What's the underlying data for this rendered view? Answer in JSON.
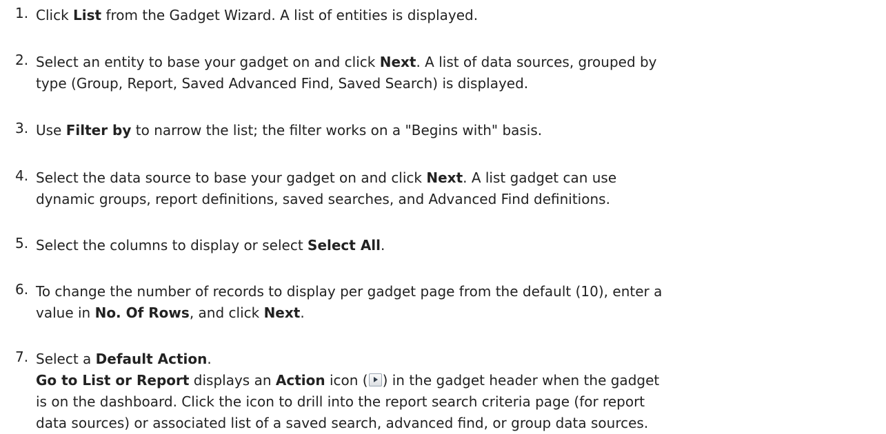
{
  "steps": [
    {
      "num": "1.",
      "lines": [
        {
          "parts": [
            {
              "t": "Click "
            },
            {
              "t": "List",
              "b": true
            },
            {
              "t": " from the Gadget Wizard. A list of entities is displayed."
            }
          ]
        }
      ]
    },
    {
      "num": "2.",
      "lines": [
        {
          "parts": [
            {
              "t": "Select an entity to base your gadget on and click "
            },
            {
              "t": "Next",
              "b": true
            },
            {
              "t": ". A list of data sources, grouped by"
            }
          ]
        },
        {
          "parts": [
            {
              "t": "type (Group, Report, Saved Advanced Find, Saved Search) is displayed."
            }
          ]
        }
      ]
    },
    {
      "num": "3.",
      "lines": [
        {
          "parts": [
            {
              "t": "Use "
            },
            {
              "t": "Filter by",
              "b": true
            },
            {
              "t": " to narrow the list; the filter works on a \"Begins with\" basis."
            }
          ]
        }
      ]
    },
    {
      "num": "4.",
      "lines": [
        {
          "parts": [
            {
              "t": "Select the data source to base your gadget on and click "
            },
            {
              "t": "Next",
              "b": true
            },
            {
              "t": ". A list gadget can use"
            }
          ]
        },
        {
          "parts": [
            {
              "t": "dynamic groups, report definitions, saved searches, and Advanced Find definitions."
            }
          ]
        }
      ]
    },
    {
      "num": "5.",
      "lines": [
        {
          "parts": [
            {
              "t": "Select the columns to display or select "
            },
            {
              "t": "Select All",
              "b": true
            },
            {
              "t": "."
            }
          ]
        }
      ]
    },
    {
      "num": "6.",
      "lines": [
        {
          "parts": [
            {
              "t": "To change the number of records to display per gadget page from the default (10), enter a"
            }
          ]
        },
        {
          "parts": [
            {
              "t": "value in "
            },
            {
              "t": "No. Of Rows",
              "b": true
            },
            {
              "t": ", and click "
            },
            {
              "t": "Next",
              "b": true
            },
            {
              "t": "."
            }
          ]
        }
      ]
    },
    {
      "num": "7.",
      "lines": [
        {
          "parts": [
            {
              "t": "Select a "
            },
            {
              "t": "Default Action",
              "b": true
            },
            {
              "t": "."
            }
          ]
        },
        {
          "parts": [
            {
              "t": "Go to List or Report",
              "b": true
            },
            {
              "t": " displays an "
            },
            {
              "t": "Action",
              "b": true
            },
            {
              "t": " icon ("
            },
            {
              "icon": "action-play-icon"
            },
            {
              "t": ") in the gadget header when the gadget"
            }
          ]
        },
        {
          "parts": [
            {
              "t": "is on the dashboard. Click the icon to drill into the report search criteria page (for report"
            }
          ]
        },
        {
          "parts": [
            {
              "t": "data sources) or associated list of a saved search, advanced find, or group data sources."
            }
          ]
        }
      ]
    }
  ]
}
